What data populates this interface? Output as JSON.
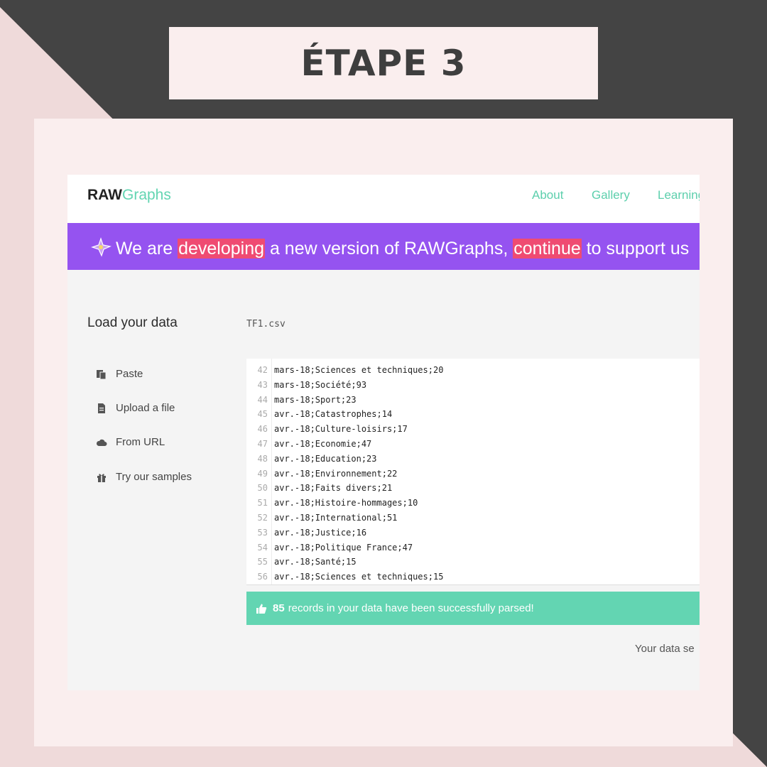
{
  "page": {
    "title": "ÉTAPE 3"
  },
  "navbar": {
    "logo_bold": "RAW",
    "logo_light": "Graphs",
    "links": [
      "About",
      "Gallery",
      "Learning"
    ]
  },
  "banner": {
    "icon": "sparkle-icon",
    "text_1": "We are ",
    "link_1": "developing",
    "text_2": " a new version of RAWGraphs, ",
    "link_2": "continue",
    "text_3": " to support us"
  },
  "sidebar": {
    "title": "Load your data",
    "items": [
      {
        "label": "Paste",
        "icon": "paste-icon"
      },
      {
        "label": "Upload a file",
        "icon": "file-icon"
      },
      {
        "label": "From URL",
        "icon": "cloud-icon"
      },
      {
        "label": "Try our samples",
        "icon": "gift-icon"
      }
    ]
  },
  "data_panel": {
    "file_name": "TF1.csv",
    "lines": [
      {
        "n": "42",
        "text": "mars-18;Sciences et techniques;20"
      },
      {
        "n": "43",
        "text": "mars-18;Société;93"
      },
      {
        "n": "44",
        "text": "mars-18;Sport;23"
      },
      {
        "n": "45",
        "text": "avr.-18;Catastrophes;14"
      },
      {
        "n": "46",
        "text": "avr.-18;Culture-loisirs;17"
      },
      {
        "n": "47",
        "text": "avr.-18;Economie;47"
      },
      {
        "n": "48",
        "text": "avr.-18;Education;23"
      },
      {
        "n": "49",
        "text": "avr.-18;Environnement;22"
      },
      {
        "n": "50",
        "text": "avr.-18;Faits divers;21"
      },
      {
        "n": "51",
        "text": "avr.-18;Histoire-hommages;10"
      },
      {
        "n": "52",
        "text": "avr.-18;International;51"
      },
      {
        "n": "53",
        "text": "avr.-18;Justice;16"
      },
      {
        "n": "54",
        "text": "avr.-18;Politique France;47"
      },
      {
        "n": "55",
        "text": "avr.-18;Santé;15"
      },
      {
        "n": "56",
        "text": "avr.-18;Sciences et techniques;15"
      }
    ],
    "status": {
      "count": "85",
      "message": "records in your data have been successfully parsed!",
      "icon": "thumbs-up-icon"
    },
    "footer": "Your data se"
  },
  "colors": {
    "accent": "#63d5b2",
    "banner": "#9553f0",
    "highlight": "#ef4b72",
    "frame_dark": "#444444",
    "frame_light": "#faeeee"
  }
}
